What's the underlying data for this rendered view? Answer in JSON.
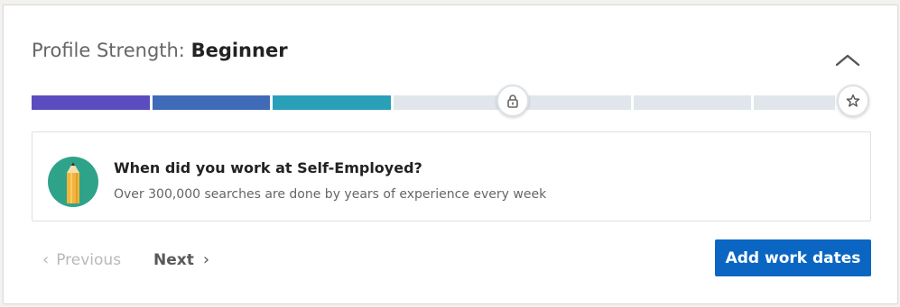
{
  "header": {
    "title_prefix": "Profile Strength:",
    "level": "Beginner",
    "collapse_icon": "chevron-up-icon"
  },
  "progress": {
    "completed_segments": 3,
    "total_segments": 7,
    "segment_colors": [
      "#5b4dbf",
      "#3e6ab8",
      "#2aa0b8"
    ],
    "track_color": "#e0e6eb",
    "milestones": [
      {
        "icon": "lock-icon"
      },
      {
        "icon": "star-icon"
      }
    ]
  },
  "prompt": {
    "icon": "pencil-icon",
    "question": "When did you work at Self-Employed?",
    "subtext": "Over 300,000 searches are done by years of experience every week"
  },
  "footer": {
    "previous_label": "Previous",
    "next_label": "Next",
    "cta_label": "Add work dates",
    "cta_color": "#0a66c2"
  }
}
